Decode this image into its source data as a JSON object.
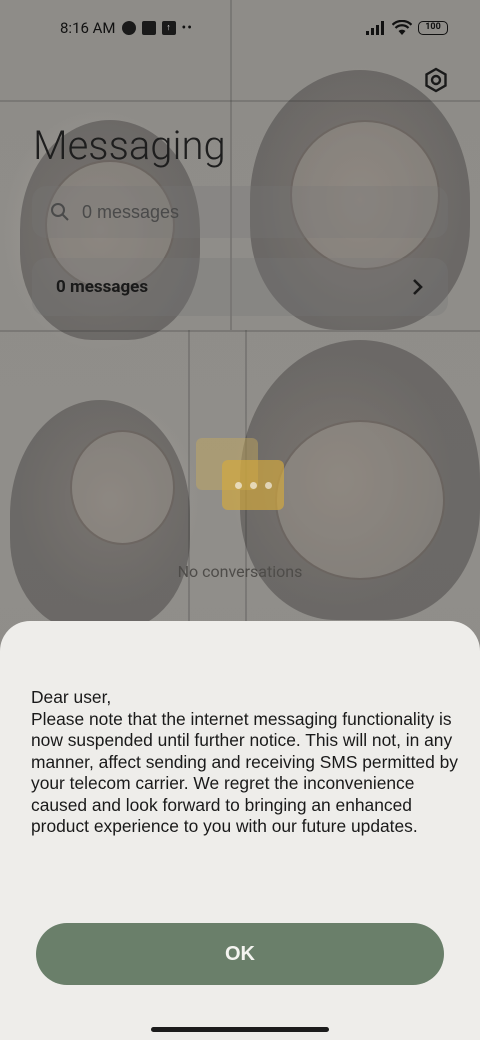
{
  "status_bar": {
    "time": "8:16 AM",
    "battery": "100",
    "icons": [
      "data-saver-icon",
      "square-icon",
      "upload-icon",
      "more-dots-icon",
      "signal-icon",
      "wifi-icon",
      "battery-icon"
    ]
  },
  "header": {
    "title": "Messaging",
    "settings_icon": "gear-icon"
  },
  "search": {
    "placeholder": "0 messages"
  },
  "message_summary": {
    "label": "0 messages"
  },
  "empty_state": {
    "text": "No conversations"
  },
  "dialog": {
    "message": "Dear user,\nPlease note that the internet messaging functionality is now suspended until further notice. This will not, in any manner, affect sending and receiving SMS permitted by your telecom carrier. We regret the inconvenience caused and look forward to bringing an enhanced product experience to you with our future updates.",
    "ok_label": "OK"
  },
  "colors": {
    "ok_button": "#6a7f6a",
    "sheet_background": "#eeedea",
    "scrim": "#8f8d89"
  }
}
